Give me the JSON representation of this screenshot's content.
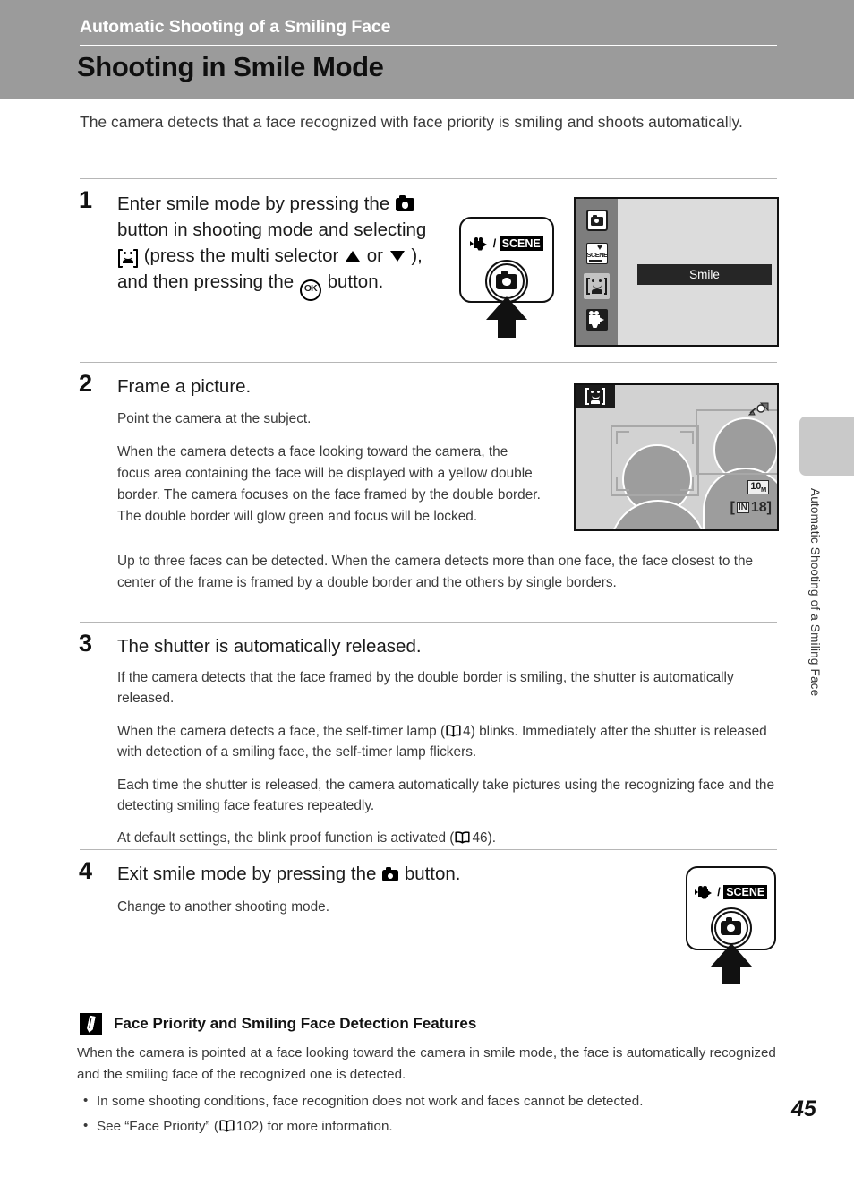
{
  "header": {
    "chapter": "Automatic Shooting of a Smiling Face",
    "title": "Shooting in Smile Mode"
  },
  "side_tab": {
    "text": "Automatic Shooting of a Smiling Face"
  },
  "intro": "The camera detects that a face recognized with face priority is smiling and shoots automatically.",
  "steps": [
    {
      "number": "1",
      "heading_part1": "Enter smile mode by pressing the",
      "heading_part2": "button in shooting mode and selecting",
      "heading_part3": "(press the multi selector",
      "heading_part4": "or",
      "heading_part5": "), and then pressing the",
      "heading_part6": "button."
    },
    {
      "number": "2",
      "heading": "Frame a picture.",
      "paragraphs": [
        "Point the camera at the subject.",
        "When the camera detects a face looking toward the camera, the focus area containing the face will be displayed with a yellow double border. The camera focuses on the face framed by the double border. The double border will glow green and focus will be locked.",
        "Up to three faces can be detected. When the camera detects more than one face, the face closest to the center of the frame is framed by a double border and the others by single borders."
      ]
    },
    {
      "number": "3",
      "heading": "The shutter is automatically released.",
      "paragraphs": [
        "If the camera detects that the face framed by the double border is smiling, the shutter is automatically released.",
        "Each time the shutter is released, the camera automatically take pictures using the recognizing face and the detecting smiling face features repeatedly."
      ],
      "selftimer_part1": "When the camera detects a face, the self-timer lamp (",
      "selftimer_ref": "4",
      "selftimer_part2": ") blinks. Immediately after the shutter is released with detection of a smiling face, the self-timer lamp flickers.",
      "blinkproof_part1": "At default settings, the blink proof function is activated (",
      "blinkproof_ref": "46",
      "blinkproof_part2": ")."
    },
    {
      "number": "4",
      "heading_part1": "Exit smile mode by pressing the",
      "heading_part2": "button.",
      "body": "Change to another shooting mode."
    }
  ],
  "lcd_menu": {
    "modes": [
      {
        "name": "auto-mode",
        "label": "Auto"
      },
      {
        "name": "scene-mode",
        "label": "Scene"
      },
      {
        "name": "smile-mode",
        "label": "Smile",
        "selected": true
      },
      {
        "name": "movie-mode",
        "label": "Movie"
      }
    ],
    "selected_label": "Smile"
  },
  "lcd_frame": {
    "image_size": "10",
    "image_size_unit": "M",
    "memory_label": "IN",
    "shots_remaining": "18",
    "bracket_open": "[",
    "bracket_close": "]"
  },
  "button_figure": {
    "scene_label": "SCENE",
    "slash": "/"
  },
  "note": {
    "title": "Face Priority and Smiling Face Detection Features",
    "body": "When the camera is pointed at a face looking toward the camera in smile mode, the face is automatically recognized and the smiling face of the recognized one is detected.",
    "bullets": [
      "In some shooting conditions, face recognition does not work and faces cannot be detected."
    ],
    "bullet_ref_part1": "See “Face Priority” (",
    "bullet_ref_page": "102",
    "bullet_ref_part2": ") for more information."
  },
  "page_number": "45",
  "colors": {
    "header_band": "#9b9b9b",
    "lcd_background": "#dcdcdc",
    "lcd_rail": "#7d7d7d",
    "selection_bar": "#262626",
    "side_tab_mark": "#c9c9c9"
  }
}
